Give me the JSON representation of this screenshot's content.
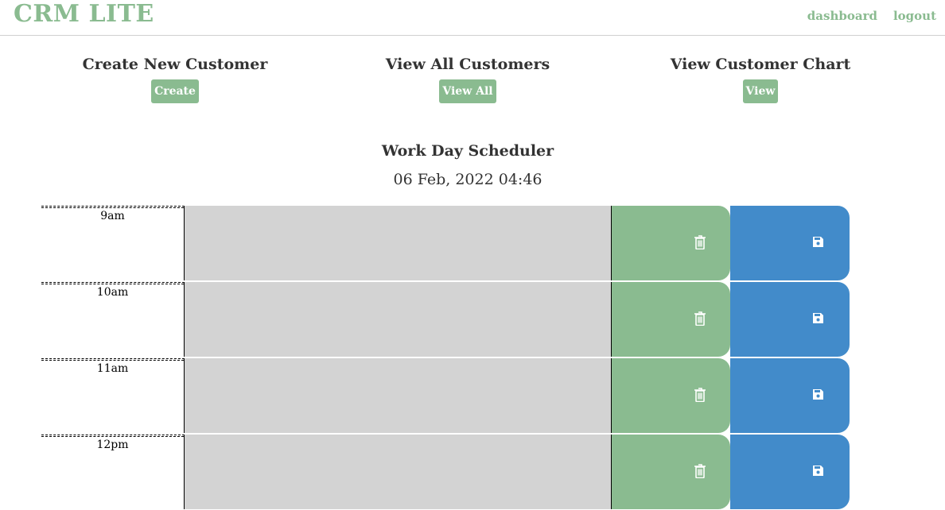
{
  "header": {
    "brand": "CRM LITE",
    "links": [
      "dashboard",
      "logout"
    ]
  },
  "actions": [
    {
      "title": "Create New Customer",
      "button": "Create"
    },
    {
      "title": "View All Customers",
      "button": "View All"
    },
    {
      "title": "View Customer Chart",
      "button": "View"
    }
  ],
  "scheduler": {
    "title": "Work Day Scheduler",
    "date": "06 Feb, 2022 04:46",
    "rows": [
      {
        "hour": "9am",
        "description": ""
      },
      {
        "hour": "10am",
        "description": ""
      },
      {
        "hour": "11am",
        "description": ""
      },
      {
        "hour": "12pm",
        "description": ""
      }
    ],
    "delete_icon": "trash-icon",
    "save_icon": "save-icon"
  },
  "colors": {
    "brand_green": "#8abb90",
    "save_blue": "#428bca",
    "textarea_gray": "#d3d3d3"
  }
}
